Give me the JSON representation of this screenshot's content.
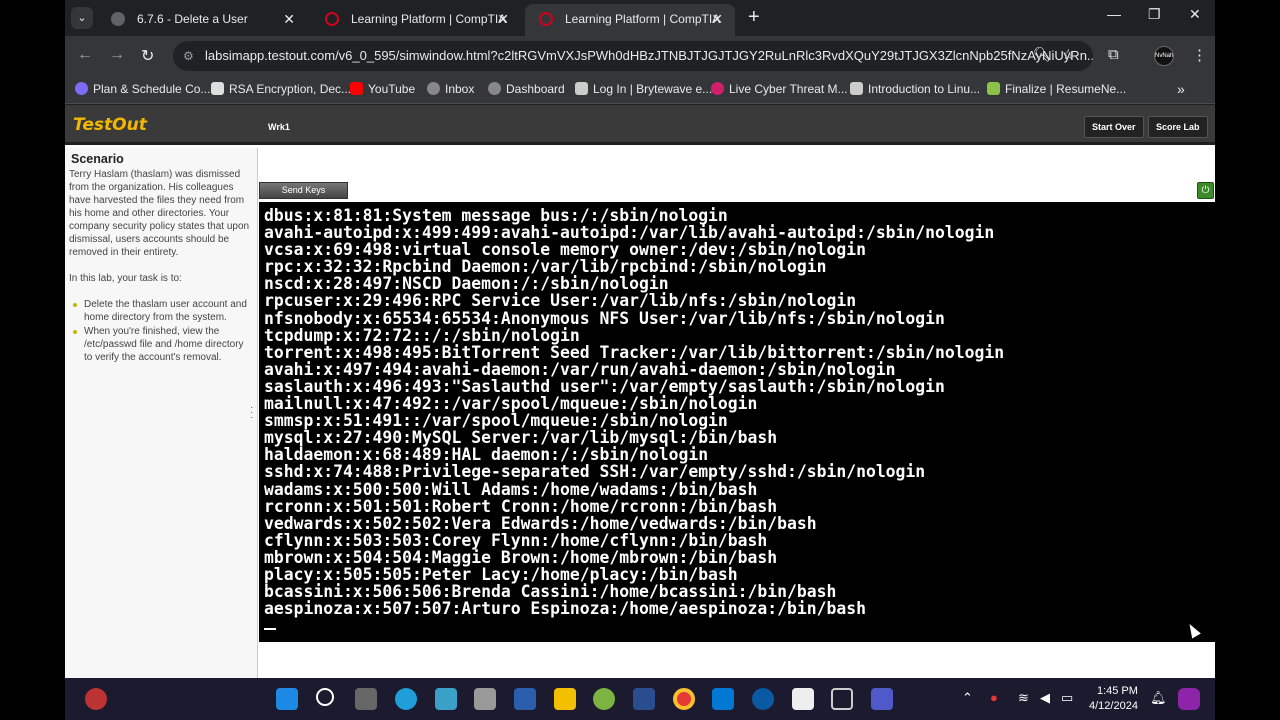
{
  "browser": {
    "tabs": [
      {
        "title": "6.7.6 - Delete a User",
        "active": false
      },
      {
        "title": "Learning Platform | CompTIA",
        "active": false
      },
      {
        "title": "Learning Platform | CompTIA",
        "active": true
      }
    ],
    "url": "labsimapp.testout.com/v6_0_595/simwindow.html?c2ltRGVmVXJsPWh0dHBzJTNBJTJGJTJGY2RuLnRlc3RvdXQuY29tJTJGX3ZlcnNpb25fNzAyNiUyRn...",
    "profile_label": "NvNah",
    "bookmarks": [
      {
        "label": "Plan & Schedule Co...",
        "icon": "circle-check-icon",
        "color": "#7b6cf6"
      },
      {
        "label": "RSA Encryption, Dec...",
        "icon": "calculator-icon",
        "color": "#ddd"
      },
      {
        "label": "YouTube",
        "icon": "youtube-icon",
        "color": "#ff0000"
      },
      {
        "label": "Inbox",
        "icon": "globe-icon",
        "color": "#888"
      },
      {
        "label": "Dashboard",
        "icon": "globe-icon",
        "color": "#888"
      },
      {
        "label": "Log In | Brytewave e...",
        "icon": "document-icon",
        "color": "#ccc"
      },
      {
        "label": "Live Cyber Threat M...",
        "icon": "threat-map-icon",
        "color": "#d01f6b"
      },
      {
        "label": "Introduction to Linu...",
        "icon": "building-icon",
        "color": "#ccc"
      },
      {
        "label": "Finalize | ResumeNe...",
        "icon": "robot-icon",
        "color": "#8bc34a"
      }
    ]
  },
  "lab": {
    "logo": "TestOut",
    "machine": "Wrk1",
    "start_over": "Start Over",
    "score_lab": "Score Lab",
    "send_keys": "Send Keys",
    "scenario_title": "Scenario",
    "scenario_text": "Terry Haslam (thaslam) was dismissed from the organization. His colleagues have harvested the files they need from his home and other directories. Your company security policy states that upon dismissal, users accounts should be removed in their entirety.",
    "task_intro": "In this lab, your task is to:",
    "tasks": [
      "Delete the thaslam user account and home directory from the system.",
      "When you're finished, view the /etc/passwd file and /home directory to verify the account's removal."
    ]
  },
  "terminal": {
    "lines": [
      "dbus:x:81:81:System message bus:/:/sbin/nologin",
      "avahi-autoipd:x:499:499:avahi-autoipd:/var/lib/avahi-autoipd:/sbin/nologin",
      "vcsa:x:69:498:virtual console memory owner:/dev:/sbin/nologin",
      "rpc:x:32:32:Rpcbind Daemon:/var/lib/rpcbind:/sbin/nologin",
      "nscd:x:28:497:NSCD Daemon:/:/sbin/nologin",
      "rpcuser:x:29:496:RPC Service User:/var/lib/nfs:/sbin/nologin",
      "nfsnobody:x:65534:65534:Anonymous NFS User:/var/lib/nfs:/sbin/nologin",
      "tcpdump:x:72:72::/:/sbin/nologin",
      "torrent:x:498:495:BitTorrent Seed Tracker:/var/lib/bittorrent:/sbin/nologin",
      "avahi:x:497:494:avahi-daemon:/var/run/avahi-daemon:/sbin/nologin",
      "saslauth:x:496:493:\"Saslauthd user\":/var/empty/saslauth:/sbin/nologin",
      "mailnull:x:47:492::/var/spool/mqueue:/sbin/nologin",
      "smmsp:x:51:491::/var/spool/mqueue:/sbin/nologin",
      "mysql:x:27:490:MySQL Server:/var/lib/mysql:/bin/bash",
      "haldaemon:x:68:489:HAL daemon:/:/sbin/nologin",
      "sshd:x:74:488:Privilege-separated SSH:/var/empty/sshd:/sbin/nologin",
      "wadams:x:500:500:Will Adams:/home/wadams:/bin/bash",
      "rcronn:x:501:501:Robert Cronn:/home/rcronn:/bin/bash",
      "vedwards:x:502:502:Vera Edwards:/home/vedwards:/bin/bash",
      "cflynn:x:503:503:Corey Flynn:/home/cflynn:/bin/bash",
      "mbrown:x:504:504:Maggie Brown:/home/mbrown:/bin/bash",
      "placy:x:505:505:Peter Lacy:/home/placy:/bin/bash",
      "bcassini:x:506:506:Brenda Cassini:/home/bcassini:/bin/bash",
      "aespinoza:x:507:507:Arturo Espinoza:/home/aespinoza:/bin/bash"
    ]
  },
  "taskbar": {
    "time": "1:45 PM",
    "date": "4/12/2024",
    "notification_count": "1"
  }
}
